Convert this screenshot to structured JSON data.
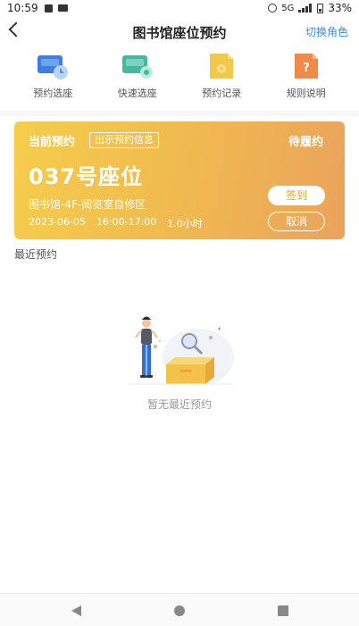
{
  "status_bar": {
    "time": "10:59",
    "network": "5G",
    "battery": "33%"
  },
  "header": {
    "title": "图书馆座位预约",
    "switch_role": "切换角色"
  },
  "menu": {
    "items": [
      {
        "label": "预约选座",
        "icon": "seat-booking-icon",
        "color": "#3d7ee0"
      },
      {
        "label": "快速选座",
        "icon": "quick-seat-icon",
        "color": "#45b8a0"
      },
      {
        "label": "预约记录",
        "icon": "record-icon",
        "color": "#f2c84b"
      },
      {
        "label": "规则说明",
        "icon": "rules-icon",
        "color": "#f08a4b"
      }
    ]
  },
  "current_booking": {
    "heading": "当前预约",
    "show_info": "出示预约信息",
    "status": "待履约",
    "seat": "037号座位",
    "location": "图书馆-4F-阅览室自修区",
    "date": "2023-06-05",
    "time": "16:00-17:00",
    "duration": "1.0小时",
    "checkin": "签到",
    "cancel": "取消"
  },
  "recent": {
    "title": "最近预约",
    "empty_text": "暂无最近预约"
  },
  "colors": {
    "accent": "#3a8ee6",
    "card_start": "#f5cd4b",
    "card_end": "#eaa35c"
  }
}
